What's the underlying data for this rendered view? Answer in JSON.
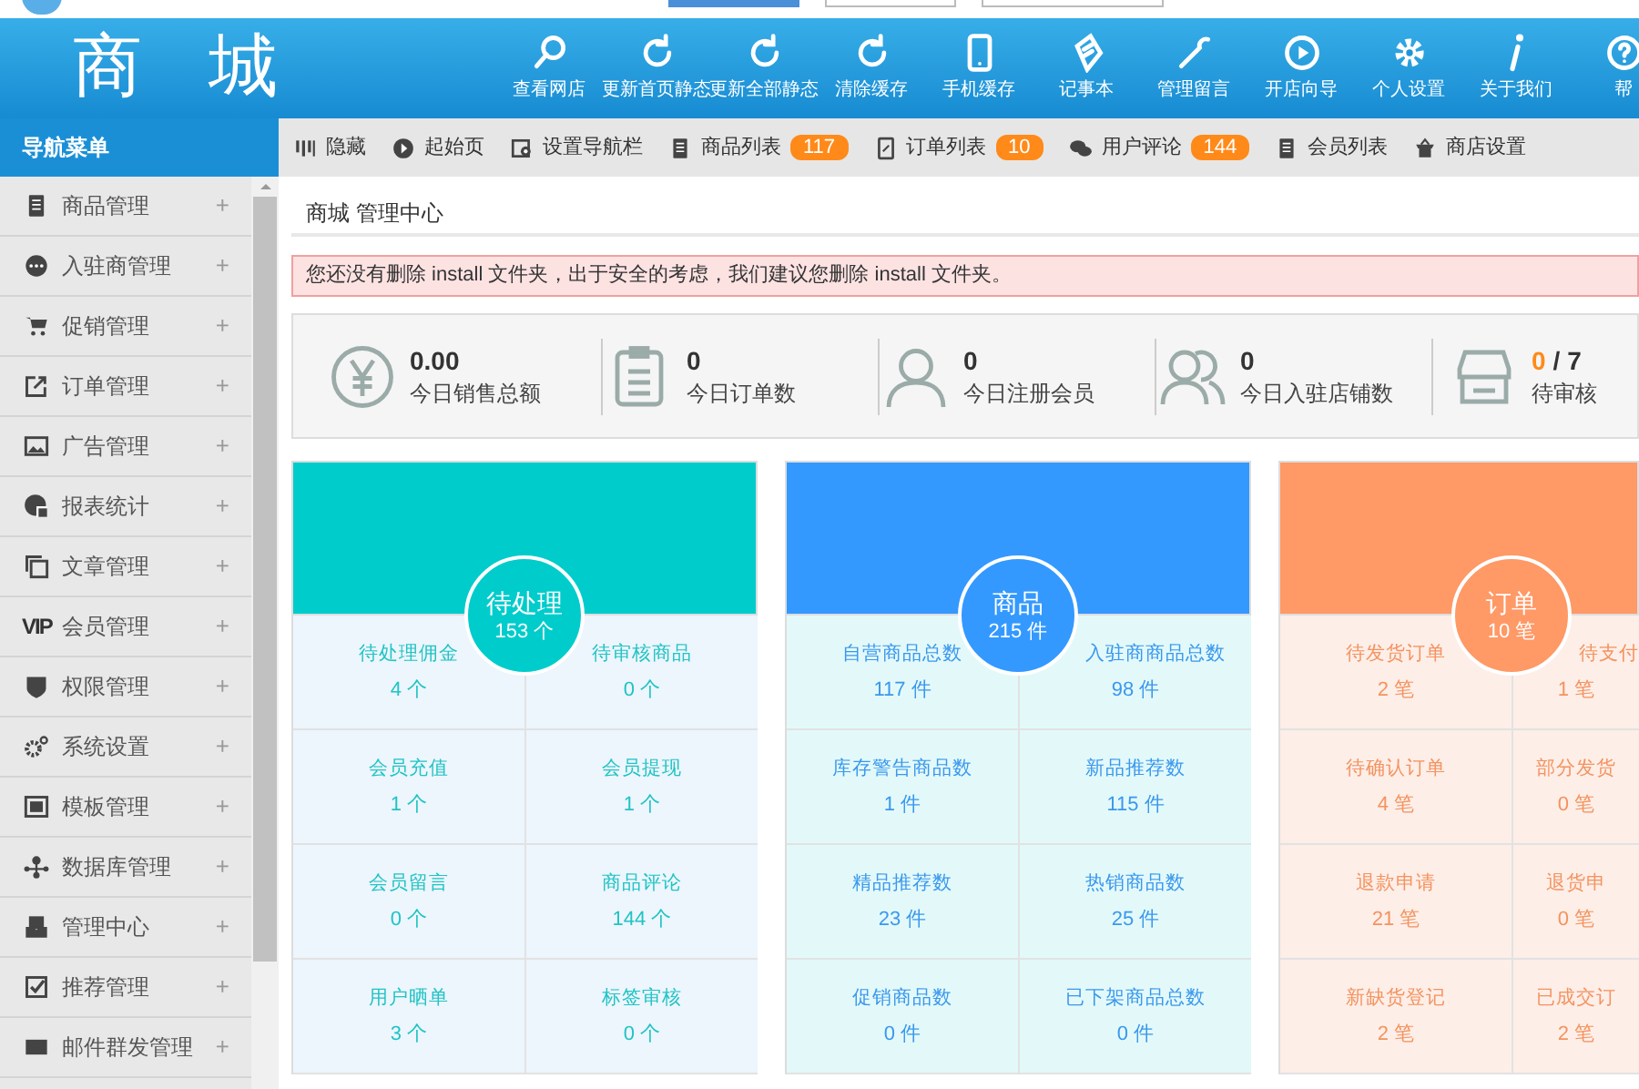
{
  "header": {
    "logo": "商 城",
    "toolbar": [
      {
        "label": "查看网店"
      },
      {
        "label": "更新首页静态"
      },
      {
        "label": "更新全部静态"
      },
      {
        "label": "清除缓存"
      },
      {
        "label": "手机缓存"
      },
      {
        "label": "记事本"
      },
      {
        "label": "管理留言"
      },
      {
        "label": "开店向导"
      },
      {
        "label": "个人设置"
      },
      {
        "label": "关于我们"
      },
      {
        "label": "帮"
      }
    ]
  },
  "nav_title": "导航菜单",
  "quick_bar": [
    {
      "label": "隐藏"
    },
    {
      "label": "起始页"
    },
    {
      "label": "设置导航栏"
    },
    {
      "label": "商品列表",
      "badge": "117"
    },
    {
      "label": "订单列表",
      "badge": "10"
    },
    {
      "label": "用户评论",
      "badge": "144"
    },
    {
      "label": "会员列表"
    },
    {
      "label": "商店设置"
    }
  ],
  "sidebar": {
    "items": [
      {
        "label": "商品管理",
        "expander": "+"
      },
      {
        "label": "入驻商管理",
        "expander": "+"
      },
      {
        "label": "促销管理",
        "expander": "+"
      },
      {
        "label": "订单管理",
        "expander": "+"
      },
      {
        "label": "广告管理",
        "expander": "+"
      },
      {
        "label": "报表统计",
        "expander": "+"
      },
      {
        "label": "文章管理",
        "expander": "+"
      },
      {
        "label": "会员管理",
        "expander": "+",
        "icon_text": "VIP"
      },
      {
        "label": "权限管理",
        "expander": "+"
      },
      {
        "label": "系统设置",
        "expander": "+"
      },
      {
        "label": "模板管理",
        "expander": "+"
      },
      {
        "label": "数据库管理",
        "expander": "+"
      },
      {
        "label": "管理中心",
        "expander": "+"
      },
      {
        "label": "推荐管理",
        "expander": "+"
      },
      {
        "label": "邮件群发管理",
        "expander": "+"
      }
    ]
  },
  "breadcrumb": "商城 管理中心",
  "alert": "您还没有删除 install 文件夹，出于安全的考虑，我们建议您删除 install 文件夹。",
  "stats": [
    {
      "value": "0.00",
      "label": "今日销售总额"
    },
    {
      "value": "0",
      "label": "今日订单数"
    },
    {
      "value": "0",
      "label": "今日注册会员"
    },
    {
      "value": "0",
      "label": "今日入驻店铺数"
    },
    {
      "value": "0",
      "suffix": "/ 7",
      "label": "待审核"
    }
  ],
  "cards": [
    {
      "title": "待处理",
      "total": "153 个",
      "color": "#00cccc",
      "items": [
        {
          "label": "待处理佣金",
          "value": "4 个"
        },
        {
          "label": "待审核商品",
          "value": "0 个"
        },
        {
          "label": "会员充值",
          "value": "1 个"
        },
        {
          "label": "会员提现",
          "value": "1 个"
        },
        {
          "label": "会员留言",
          "value": "0 个"
        },
        {
          "label": "商品评论",
          "value": "144 个"
        },
        {
          "label": "用户晒单",
          "value": "3 个"
        },
        {
          "label": "标签审核",
          "value": "0 个"
        }
      ]
    },
    {
      "title": "商品",
      "total": "215 件",
      "color": "#3399ff",
      "items": [
        {
          "label": "自营商品总数",
          "value": "117 件"
        },
        {
          "label": "入驻商商品总数",
          "value": "98 件"
        },
        {
          "label": "库存警告商品数",
          "value": "1 件"
        },
        {
          "label": "新品推荐数",
          "value": "115 件"
        },
        {
          "label": "精品推荐数",
          "value": "23 件"
        },
        {
          "label": "热销商品数",
          "value": "25 件"
        },
        {
          "label": "促销商品数",
          "value": "0 件"
        },
        {
          "label": "已下架商品总数",
          "value": "0 件"
        }
      ]
    },
    {
      "title": "订单",
      "total": "10 笔",
      "color": "#ff9966",
      "items": [
        {
          "label": "待发货订单",
          "value": "2 笔"
        },
        {
          "label": "待支付",
          "value": "1 笔"
        },
        {
          "label": "待确认订单",
          "value": "4 笔"
        },
        {
          "label": "部分发货",
          "value": "0 笔"
        },
        {
          "label": "退款申请",
          "value": "21 笔"
        },
        {
          "label": "退货申",
          "value": "0 笔"
        },
        {
          "label": "新缺货登记",
          "value": "2 笔"
        },
        {
          "label": "已成交订",
          "value": "2 笔"
        }
      ]
    }
  ]
}
